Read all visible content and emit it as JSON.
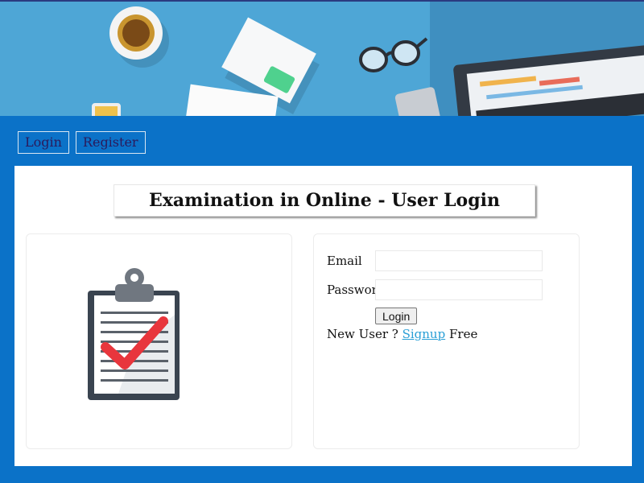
{
  "nav": {
    "login_label": "Login",
    "register_label": "Register"
  },
  "page_title": "Examination in Online - User Login",
  "form": {
    "email_label": "Email",
    "email_value": "",
    "password_label": "Password",
    "password_value": "",
    "submit_label": "Login",
    "signup_prefix": "New User ?",
    "signup_link": "Signup",
    "signup_suffix": "Free"
  },
  "colors": {
    "page_background": "#0b72c8",
    "banner_background": "#4ea6d6",
    "link": "#2a9fd6",
    "checkmark": "#e8363d"
  },
  "icons": {
    "banner": "workspace-illustration",
    "left_card": "clipboard-checkmark-icon"
  }
}
